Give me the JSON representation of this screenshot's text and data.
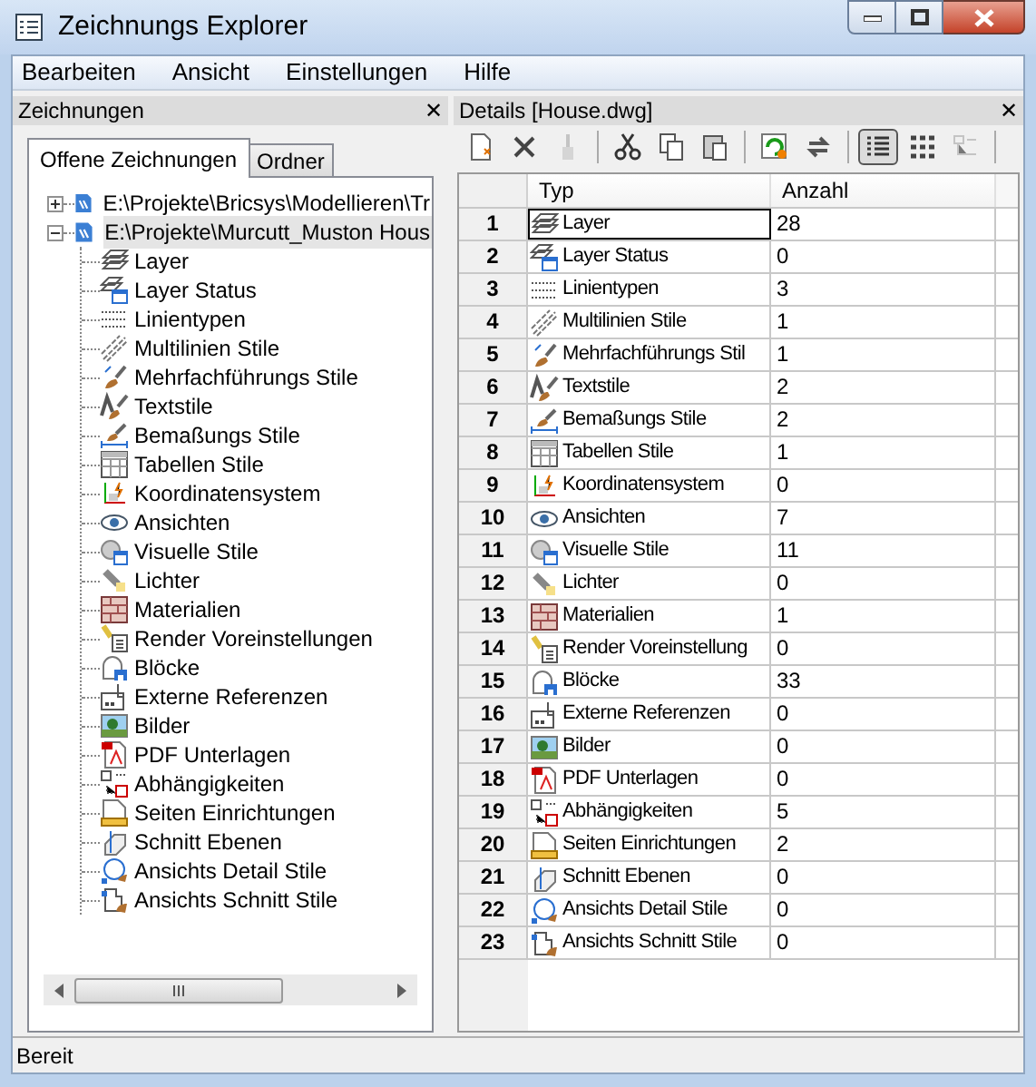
{
  "window": {
    "title": "Zeichnungs Explorer"
  },
  "menu": [
    "Bearbeiten",
    "Ansicht",
    "Einstellungen",
    "Hilfe"
  ],
  "left_panel": {
    "title": "Zeichnungen",
    "close": "✕"
  },
  "tabs": [
    {
      "label": "Offene Zeichnungen",
      "selected": true
    },
    {
      "label": "Ordner",
      "selected": false
    }
  ],
  "tree": [
    {
      "label": "E:\\Projekte\\Bricsys\\Modellieren\\Tr",
      "expanded": false,
      "selected": false
    },
    {
      "label": "E:\\Projekte\\Murcutt_Muston Hous",
      "expanded": true,
      "selected": true,
      "children": [
        "Layer",
        "Layer Status",
        "Linientypen",
        "Multilinien Stile",
        "Mehrfachführungs Stile",
        "Textstile",
        "Bemaßungs Stile",
        "Tabellen Stile",
        "Koordinatensystem",
        "Ansichten",
        "Visuelle Stile",
        "Lichter",
        "Materialien",
        "Render Voreinstellungen",
        "Blöcke",
        "Externe Referenzen",
        "Bilder",
        "PDF Unterlagen",
        "Abhängigkeiten",
        "Seiten Einrichtungen",
        "Schnitt Ebenen",
        "Ansichts Detail Stile",
        "Ansichts Schnitt Stile"
      ]
    }
  ],
  "right_panel": {
    "title": "Details [House.dwg]",
    "close": "✕"
  },
  "toolbar": [
    {
      "disabled": false,
      "selected": false
    },
    {
      "disabled": false,
      "selected": false
    },
    {
      "disabled": true,
      "selected": false
    },
    {
      "disabled": false,
      "selected": false
    },
    {
      "disabled": false,
      "selected": false
    },
    {
      "disabled": false,
      "selected": false
    },
    {
      "disabled": false,
      "selected": false
    },
    {
      "disabled": false,
      "selected": false
    },
    {
      "disabled": false,
      "selected": true
    },
    {
      "disabled": false,
      "selected": false
    },
    {
      "disabled": true,
      "selected": false
    }
  ],
  "table": {
    "columns": [
      "Typ",
      "Anzahl"
    ],
    "rows": [
      {
        "number": "1",
        "typ": "Layer",
        "anzahl": "28",
        "selected": true
      },
      {
        "number": "2",
        "typ": "Layer Status",
        "anzahl": "0",
        "selected": false
      },
      {
        "number": "3",
        "typ": "Linientypen",
        "anzahl": "3",
        "selected": false
      },
      {
        "number": "4",
        "typ": "Multilinien Stile",
        "anzahl": "1",
        "selected": false
      },
      {
        "number": "5",
        "typ": "Mehrfachführungs Stil",
        "anzahl": "1",
        "selected": false
      },
      {
        "number": "6",
        "typ": "Textstile",
        "anzahl": "2",
        "selected": false
      },
      {
        "number": "7",
        "typ": "Bemaßungs Stile",
        "anzahl": "2",
        "selected": false
      },
      {
        "number": "8",
        "typ": "Tabellen Stile",
        "anzahl": "1",
        "selected": false
      },
      {
        "number": "9",
        "typ": "Koordinatensystem",
        "anzahl": "0",
        "selected": false
      },
      {
        "number": "10",
        "typ": "Ansichten",
        "anzahl": "7",
        "selected": false
      },
      {
        "number": "11",
        "typ": "Visuelle Stile",
        "anzahl": "11",
        "selected": false
      },
      {
        "number": "12",
        "typ": "Lichter",
        "anzahl": "0",
        "selected": false
      },
      {
        "number": "13",
        "typ": "Materialien",
        "anzahl": "1",
        "selected": false
      },
      {
        "number": "14",
        "typ": "Render Voreinstellung",
        "anzahl": "0",
        "selected": false
      },
      {
        "number": "15",
        "typ": "Blöcke",
        "anzahl": "33",
        "selected": false
      },
      {
        "number": "16",
        "typ": "Externe Referenzen",
        "anzahl": "0",
        "selected": false
      },
      {
        "number": "17",
        "typ": "Bilder",
        "anzahl": "0",
        "selected": false
      },
      {
        "number": "18",
        "typ": "PDF Unterlagen",
        "anzahl": "0",
        "selected": false
      },
      {
        "number": "19",
        "typ": "Abhängigkeiten",
        "anzahl": "5",
        "selected": false
      },
      {
        "number": "20",
        "typ": "Seiten Einrichtungen",
        "anzahl": "2",
        "selected": false
      },
      {
        "number": "21",
        "typ": "Schnitt Ebenen",
        "anzahl": "0",
        "selected": false
      },
      {
        "number": "22",
        "typ": "Ansichts Detail Stile",
        "anzahl": "0",
        "selected": false
      },
      {
        "number": "23",
        "typ": "Ansichts Schnitt Stile",
        "anzahl": "0",
        "selected": false
      }
    ]
  },
  "status_bar": "Bereit"
}
